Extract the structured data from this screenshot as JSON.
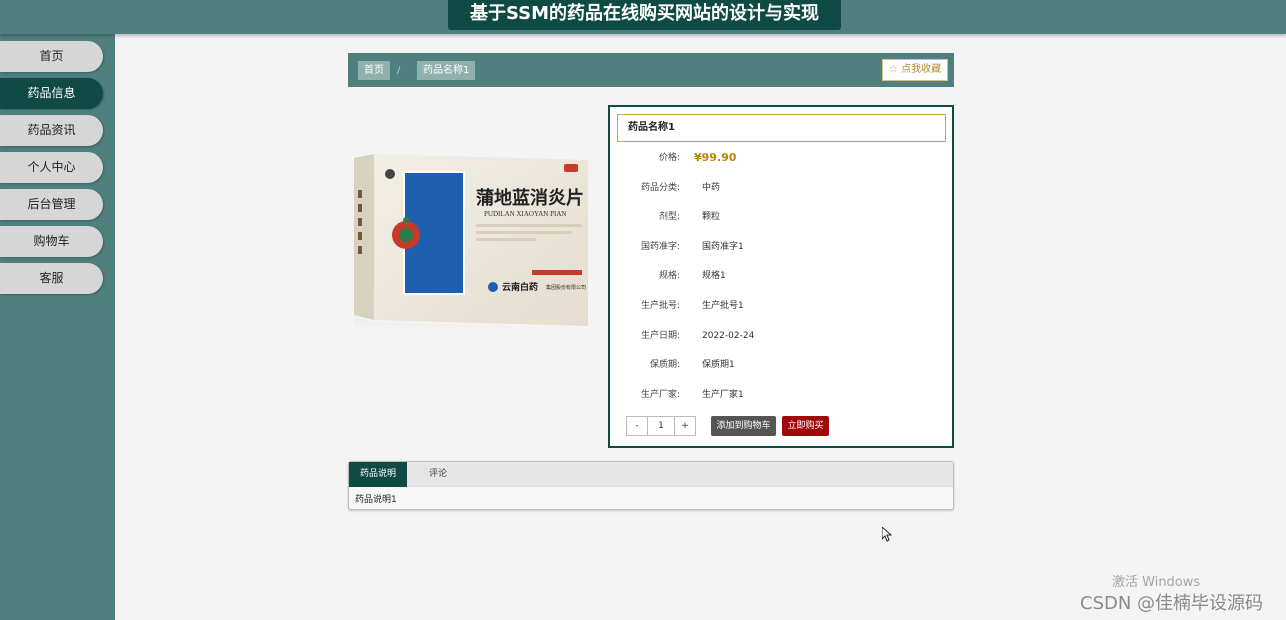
{
  "site": {
    "title": "基于SSM的药品在线购买网站的设计与实现"
  },
  "nav": {
    "items": [
      {
        "label": "首页",
        "active": false
      },
      {
        "label": "药品信息",
        "active": true
      },
      {
        "label": "药品资讯",
        "active": false
      },
      {
        "label": "个人中心",
        "active": false
      },
      {
        "label": "后台管理",
        "active": false
      },
      {
        "label": "购物车",
        "active": false
      },
      {
        "label": "客服",
        "active": false
      }
    ]
  },
  "breadcrumb": {
    "home": "首页",
    "separator": "/",
    "current": "药品名称1",
    "favorite_label": "☆ 点我收藏"
  },
  "product_image": {
    "name_cn": "蒲地蓝消炎片",
    "name_py": "PUDILAN XIAOYAN PIAN",
    "brand": "云南白药",
    "company": "集团股份有限公司"
  },
  "product": {
    "name": "药品名称1",
    "price_label": "价格:",
    "price": "¥99.90",
    "fields": [
      {
        "label": "药品分类:",
        "value": "中药"
      },
      {
        "label": "剂型:",
        "value": "颗粒"
      },
      {
        "label": "国药准字:",
        "value": "国药准字1"
      },
      {
        "label": "规格:",
        "value": "规格1"
      },
      {
        "label": "生产批号:",
        "value": "生产批号1"
      },
      {
        "label": "生产日期:",
        "value": "2022-02-24"
      },
      {
        "label": "保质期:",
        "value": "保质期1"
      },
      {
        "label": "生产厂家:",
        "value": "生产厂家1"
      }
    ],
    "qty_minus": "-",
    "qty_value": "1",
    "qty_plus": "+",
    "add_cart_label": "添加到购物车",
    "buy_now_label": "立即购买"
  },
  "tabs": {
    "items": [
      {
        "label": "药品说明"
      },
      {
        "label": "评论"
      }
    ],
    "content": "药品说明1"
  },
  "watermark": {
    "windows": "激活 Windows",
    "csdn": "CSDN @佳楠毕设源码"
  },
  "colors": {
    "primary_dark": "#0f4a45",
    "primary": "#4f807e",
    "price": "#b9860b",
    "buy": "#a10a0a"
  }
}
